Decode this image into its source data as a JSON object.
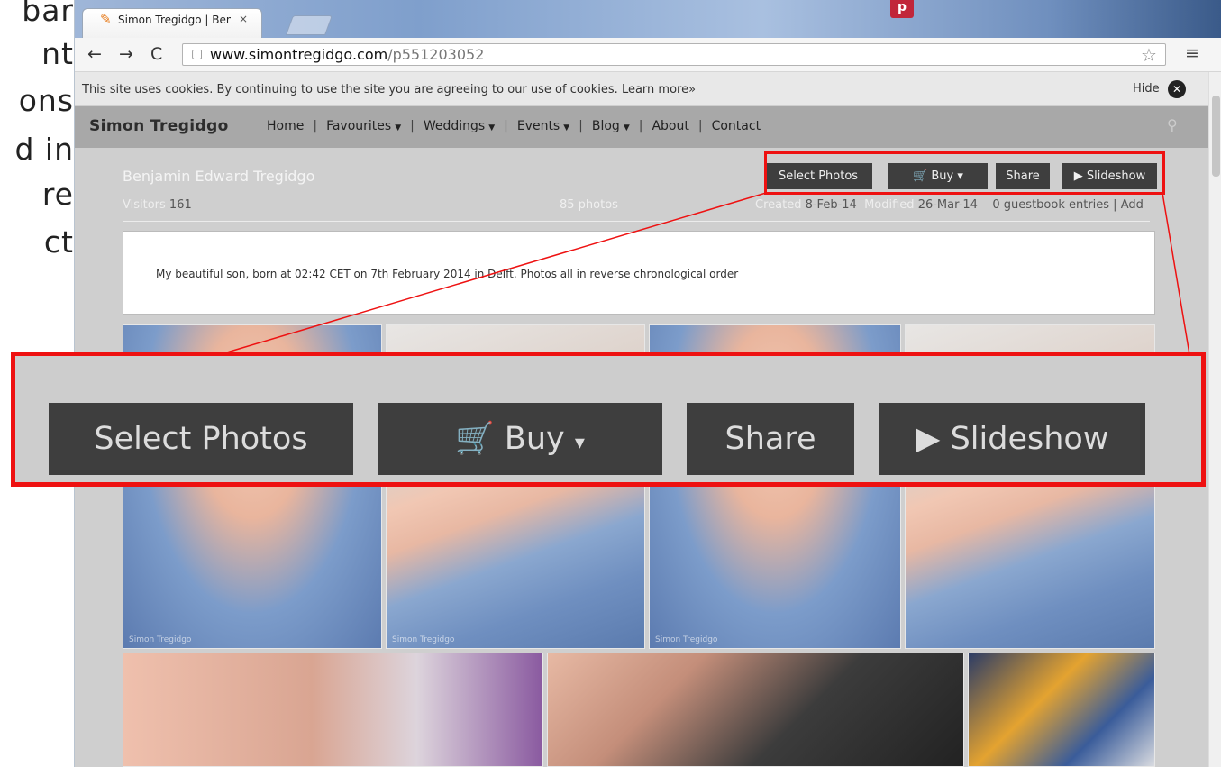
{
  "side_text": [
    "bar",
    "nt",
    "ons",
    "d in",
    "re",
    "ct"
  ],
  "browser": {
    "tab_title": "Simon Tregidgo | Benjami",
    "tab_close": "×",
    "url_host": "www.simontregidgo.com",
    "url_path": "/p551203052"
  },
  "cookie": {
    "text": "This site uses cookies. By continuing to use the site you are agreeing to our use of cookies. Learn more»",
    "hide": "Hide"
  },
  "site": {
    "brand": "Simon Tregidgo",
    "nav": [
      {
        "label": "Home",
        "caret": false
      },
      {
        "label": "Favourites",
        "caret": true
      },
      {
        "label": "Weddings",
        "caret": true
      },
      {
        "label": "Events",
        "caret": true
      },
      {
        "label": "Blog",
        "caret": true
      },
      {
        "label": "About",
        "caret": false
      },
      {
        "label": "Contact",
        "caret": false
      }
    ]
  },
  "gallery": {
    "title": "Benjamin Edward Tregidgo",
    "visitors_label": "Visitors",
    "visitors_value": "161",
    "photo_count": "85 photos",
    "created_label": "Created",
    "created_value": "8-Feb-14",
    "modified_label": "Modified",
    "modified_value": "26-Mar-14",
    "guestbook": "0 guestbook entries | Add",
    "description": "My beautiful son, born at 02:42 CET on 7th February 2014 in Delft. Photos all in reverse chronological order",
    "buttons": {
      "select": "Select Photos",
      "buy": "Buy",
      "buy_caret": "▾",
      "share": "Share",
      "slideshow": "Slideshow",
      "slideshow_icon": "▶"
    },
    "watermark": "Simon Tregidgo"
  }
}
